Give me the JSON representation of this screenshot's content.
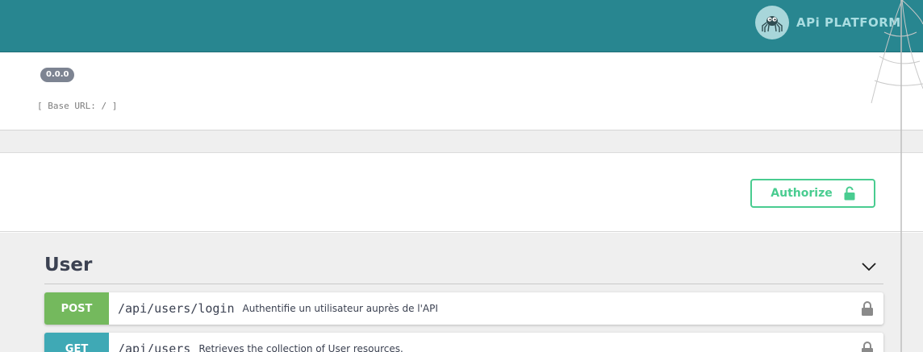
{
  "header": {
    "logo_icon": "spider-icon",
    "logo_text": "APi PLATFORM",
    "background": "#288690"
  },
  "info": {
    "version": "0.0.0",
    "base_url": "[ Base URL: / ]"
  },
  "auth": {
    "authorize_label": "Authorize",
    "icon": "unlock-icon",
    "color": "#49cc90"
  },
  "tag": {
    "title": "User",
    "toggle_icon": "chevron-down-icon"
  },
  "operations": [
    {
      "method": "POST",
      "path": "/api/users/login",
      "summary": "Authentifie un utilisateur auprès de l'API",
      "color": "#74b95d",
      "lock_icon": "lock-icon"
    },
    {
      "method": "GET",
      "path": "/api/users",
      "summary": "Retrieves the collection of User resources.",
      "color": "#3fa9b5",
      "lock_icon": "lock-icon"
    }
  ]
}
